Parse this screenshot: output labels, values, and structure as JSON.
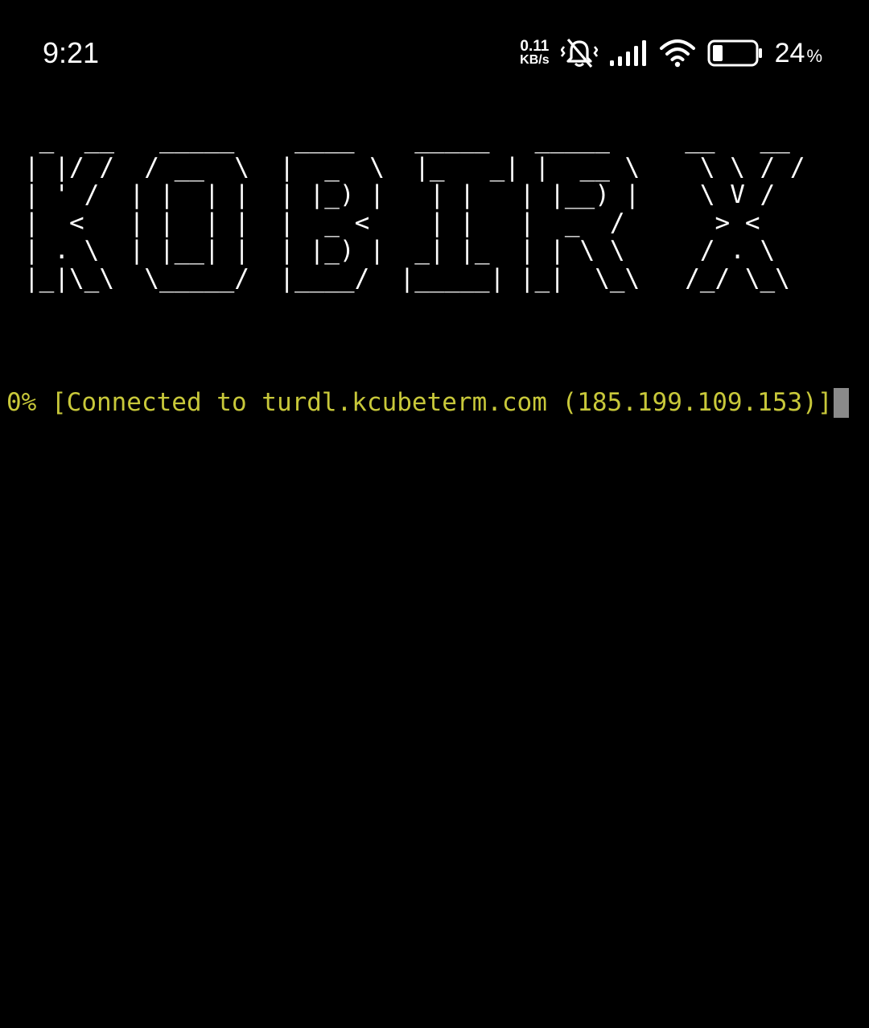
{
  "status_bar": {
    "time": "9:21",
    "net_speed_value": "0.11",
    "net_speed_unit": "KB/s",
    "battery_value": "24",
    "battery_symbol": "%",
    "battery_level": 0.24,
    "icons": [
      "vibrate-off-icon",
      "cellular-signal-icon",
      "wifi-icon",
      "battery-icon"
    ]
  },
  "terminal": {
    "banner": " _  __   _____    ____    _____   _____     __   __\n| |/ /  / __  \\  |  _  \\  |_   _| |  __ \\    \\ \\ / /\n| ' /  | |  | |  | |_) |   | |   | |__) |    \\ V /\n|  <   | |  | |  |  _ <    | |   |  _  /      > <\n| . \\  | |__| |  | |_) |  _| |_  | | \\ \\     / . \\\n|_|\\_\\  \\_____/  |____/  |_____| |_|  \\_\\   /_/ \\_\\",
    "output_line": "0% [Connected to turdl.kcubeterm.com (185.199.109.153)]",
    "text_color": "#ffffff",
    "output_color": "#c8c83a",
    "cursor_color": "#8a8a8a"
  }
}
